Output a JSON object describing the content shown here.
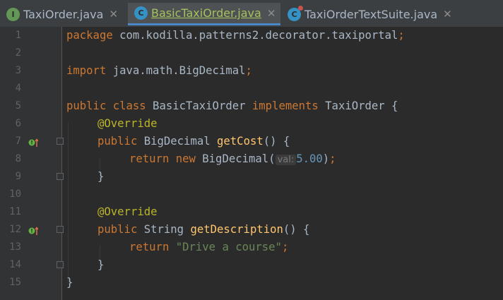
{
  "tabs": [
    {
      "name": "TaxiOrder.java",
      "icon": "I",
      "active": false
    },
    {
      "name": "BasicTaxiOrder.java",
      "icon": "C",
      "active": true
    },
    {
      "name": "TaxiOrderTextSuite.java",
      "icon": "C",
      "active": false
    }
  ],
  "tab_close_glyph": "✕",
  "hint_label": "val:",
  "line_numbers": [
    "1",
    "2",
    "3",
    "4",
    "5",
    "6",
    "7",
    "8",
    "9",
    "10",
    "11",
    "12",
    "13",
    "14",
    "15"
  ],
  "colors": {
    "background": "#2b2b2b",
    "keyword": "#cc7832",
    "annotation": "#bbb529",
    "method": "#ffc66d",
    "string": "#6a8759",
    "number": "#6897bb",
    "text": "#a9b7c6",
    "active_tab_underline": "#4a88c7"
  },
  "code": {
    "l1": {
      "kw": "package",
      "rest": " com.kodilla.patterns2.decorator.taxiportal",
      "semi": ";"
    },
    "l3": {
      "kw": "import",
      "rest": " java.math.BigDecimal",
      "semi": ";"
    },
    "l5": {
      "kw1": "public class",
      "name": " BasicTaxiOrder ",
      "kw2": "implements",
      "rest": " TaxiOrder {"
    },
    "l6": {
      "ann": "@Override"
    },
    "l7": {
      "kw": "public",
      "type": " BigDecimal ",
      "fn": "getCost",
      "rest": "() {"
    },
    "l8": {
      "kw": "return new",
      "type": " BigDecimal(",
      "num": "5.00",
      "rest": ")",
      "semi": ";"
    },
    "l9": {
      "text": "}"
    },
    "l11": {
      "ann": "@Override"
    },
    "l12": {
      "kw": "public",
      "type": " String ",
      "fn": "getDescription",
      "rest": "() {"
    },
    "l13": {
      "kw": "return",
      "str": "\"Drive a course\"",
      "semi": ";"
    },
    "l14": {
      "text": "}"
    },
    "l15": {
      "text": "}"
    }
  },
  "gutter_icons": {
    "l7": "implements-method-icon",
    "l12": "implements-method-icon"
  }
}
